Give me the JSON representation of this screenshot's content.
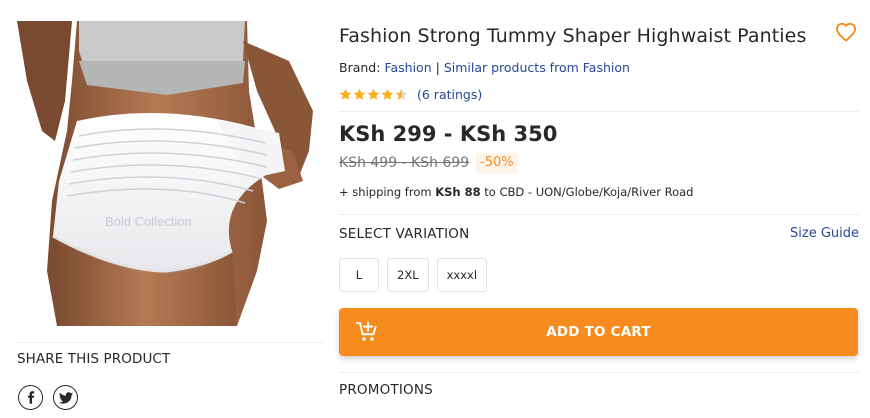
{
  "product": {
    "title": "Fashion Strong Tummy Shaper Highwaist Panties",
    "brand_label": "Brand:",
    "brand_name": "Fashion",
    "brand_separator": "|",
    "similar_link": "Similar products from Fashion",
    "rating_value": 4.5,
    "rating_max": 5,
    "ratings_text": "(6 ratings)",
    "price_range": "KSh 299 - KSh 350",
    "old_price_range": "KSh 499 - KSh 699",
    "discount": "-50%",
    "shipping_prefix": "+ shipping from",
    "shipping_amount": "KSh 88",
    "shipping_suffix": "to CBD - UON/Globe/Koja/River Road",
    "image_watermark": "Bold Collection"
  },
  "variation": {
    "title": "SELECT VARIATION",
    "size_guide": "Size Guide",
    "options": [
      "L",
      "2XL",
      "xxxxl"
    ]
  },
  "cart": {
    "label": "ADD TO CART",
    "icon": "cart-plus-icon"
  },
  "share": {
    "title": "SHARE THIS PRODUCT",
    "networks": [
      "facebook-icon",
      "twitter-icon"
    ]
  },
  "promotions": {
    "title": "PROMOTIONS"
  },
  "colors": {
    "accent": "#f68b1e",
    "link": "#264996",
    "star": "#f6b01e",
    "discount_bg": "#fef3e9",
    "text": "#282828"
  }
}
